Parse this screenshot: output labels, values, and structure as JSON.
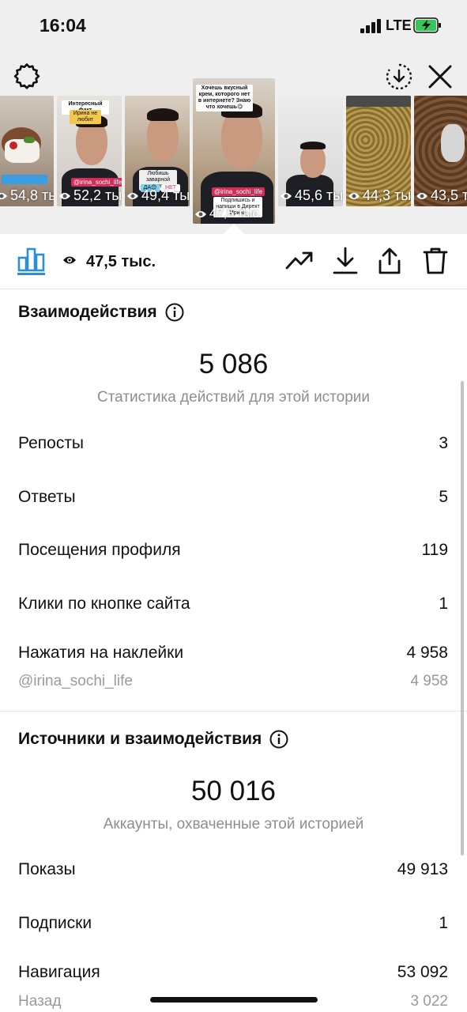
{
  "status_bar": {
    "time": "16:04",
    "network": "LTE",
    "battery_charging": true,
    "battery_color": "#35c759"
  },
  "top_controls": {
    "settings_icon": "gear-icon",
    "download_icon": "download-circle-icon",
    "close_icon": "close-icon"
  },
  "stories": [
    {
      "views": "54,8 ты",
      "selected": false
    },
    {
      "views": "52,2 ты",
      "selected": false,
      "caption": "Интересный факт",
      "sub": "Ирина не любит",
      "handle": "@irina_sochi_life"
    },
    {
      "views": "49,4 ты",
      "selected": false,
      "caption": "Любишь заварной крем",
      "yes": "ДА😊",
      "no": "НЕТ"
    },
    {
      "views": "47,5 тыс.",
      "selected": true,
      "caption": "Хочешь вкусный крем, которого нет в интернете? Знаю что хочешь😋",
      "handle": "@irina_sochi_life",
      "footer": "Подпишись и напиши в Директ Ирина"
    },
    {
      "views": "45,6 ты",
      "selected": false
    },
    {
      "views": "44,3 ты",
      "selected": false
    },
    {
      "views": "43,5 ты",
      "selected": false
    }
  ],
  "toolbar": {
    "views": "47,5 тыс.",
    "active_tab_color": "#2b8fd8"
  },
  "interactions": {
    "title": "Взаимодействия",
    "total": "5 086",
    "subtitle": "Статистика действий для этой истории",
    "rows": [
      {
        "label": "Репосты",
        "value": "3"
      },
      {
        "label": "Ответы",
        "value": "5"
      },
      {
        "label": "Посещения профиля",
        "value": "119"
      },
      {
        "label": "Клики по кнопке сайта",
        "value": "1"
      },
      {
        "label": "Нажатия на наклейки",
        "value": "4 958"
      }
    ],
    "sticker_row": {
      "label": "@irina_sochi_life",
      "value": "4 958"
    }
  },
  "discovery": {
    "title": "Источники и взаимодействия",
    "total": "50 016",
    "subtitle": "Аккаунты, охваченные этой историей",
    "rows": [
      {
        "label": "Показы",
        "value": "49 913"
      },
      {
        "label": "Подписки",
        "value": "1"
      },
      {
        "label": "Навигация",
        "value": "53 092"
      }
    ],
    "sub_row": {
      "label": "Назад",
      "value": "3 022"
    }
  }
}
